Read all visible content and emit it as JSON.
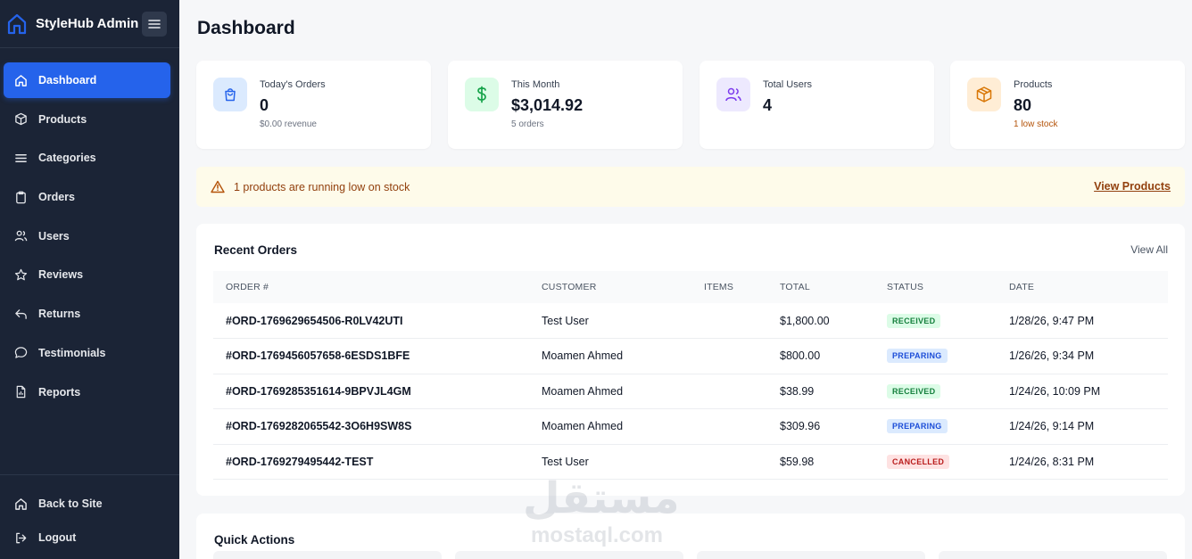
{
  "brand": {
    "title": "StyleHub Admin",
    "color": "#2563eb"
  },
  "sidebar": {
    "items": [
      {
        "label": "Dashboard",
        "icon": "home-icon",
        "active": true
      },
      {
        "label": "Products",
        "icon": "box-icon"
      },
      {
        "label": "Categories",
        "icon": "list-icon"
      },
      {
        "label": "Orders",
        "icon": "clipboard-icon"
      },
      {
        "label": "Users",
        "icon": "users-icon"
      },
      {
        "label": "Reviews",
        "icon": "star-icon"
      },
      {
        "label": "Returns",
        "icon": "undo-icon"
      },
      {
        "label": "Testimonials",
        "icon": "message-icon"
      },
      {
        "label": "Reports",
        "icon": "file-icon"
      }
    ],
    "bottom": [
      {
        "label": "Back to Site",
        "icon": "home-icon"
      },
      {
        "label": "Logout",
        "icon": "logout-icon"
      }
    ]
  },
  "page": {
    "title": "Dashboard"
  },
  "stats": [
    {
      "label": "Today's Orders",
      "value": "0",
      "sub": "$0.00 revenue",
      "icon": "shopping-bag-icon",
      "color": "#2563eb",
      "bg": "#dbeafe"
    },
    {
      "label": "This Month",
      "value": "$3,014.92",
      "sub": "5 orders",
      "icon": "dollar-icon",
      "color": "#16a34a",
      "bg": "#dcfce7"
    },
    {
      "label": "Total Users",
      "value": "4",
      "sub": "",
      "icon": "users-icon",
      "color": "#7c3aed",
      "bg": "#ede9fe"
    },
    {
      "label": "Products",
      "value": "80",
      "sub": "1 low stock",
      "icon": "package-icon",
      "color": "#d97706",
      "bg": "#ffedd5"
    }
  ],
  "alert": {
    "text": "1 products are running low on stock",
    "link": "View Products"
  },
  "orders": {
    "title": "Recent Orders",
    "view_all": "View All",
    "columns": [
      "ORDER #",
      "CUSTOMER",
      "ITEMS",
      "TOTAL",
      "STATUS",
      "DATE"
    ],
    "rows": [
      {
        "order": "#ORD-1769629654506-R0LV42UTI",
        "customer": "Test User",
        "items": "",
        "total": "$1,800.00",
        "status": "RECEIVED",
        "date": "1/28/26, 9:47 PM"
      },
      {
        "order": "#ORD-1769456057658-6ESDS1BFE",
        "customer": "Moamen Ahmed",
        "items": "",
        "total": "$800.00",
        "status": "PREPARING",
        "date": "1/26/26, 9:34 PM"
      },
      {
        "order": "#ORD-1769285351614-9BPVJL4GM",
        "customer": "Moamen Ahmed",
        "items": "",
        "total": "$38.99",
        "status": "RECEIVED",
        "date": "1/24/26, 10:09 PM"
      },
      {
        "order": "#ORD-1769282065542-3O6H9SW8S",
        "customer": "Moamen Ahmed",
        "items": "",
        "total": "$309.96",
        "status": "PREPARING",
        "date": "1/24/26, 9:14 PM"
      },
      {
        "order": "#ORD-1769279495442-TEST",
        "customer": "Test User",
        "items": "",
        "total": "$59.98",
        "status": "CANCELLED",
        "date": "1/24/26, 8:31 PM"
      }
    ]
  },
  "quick_actions": {
    "title": "Quick Actions"
  },
  "watermark": {
    "arabic": "مستقل",
    "latin": "mostaql.com"
  }
}
